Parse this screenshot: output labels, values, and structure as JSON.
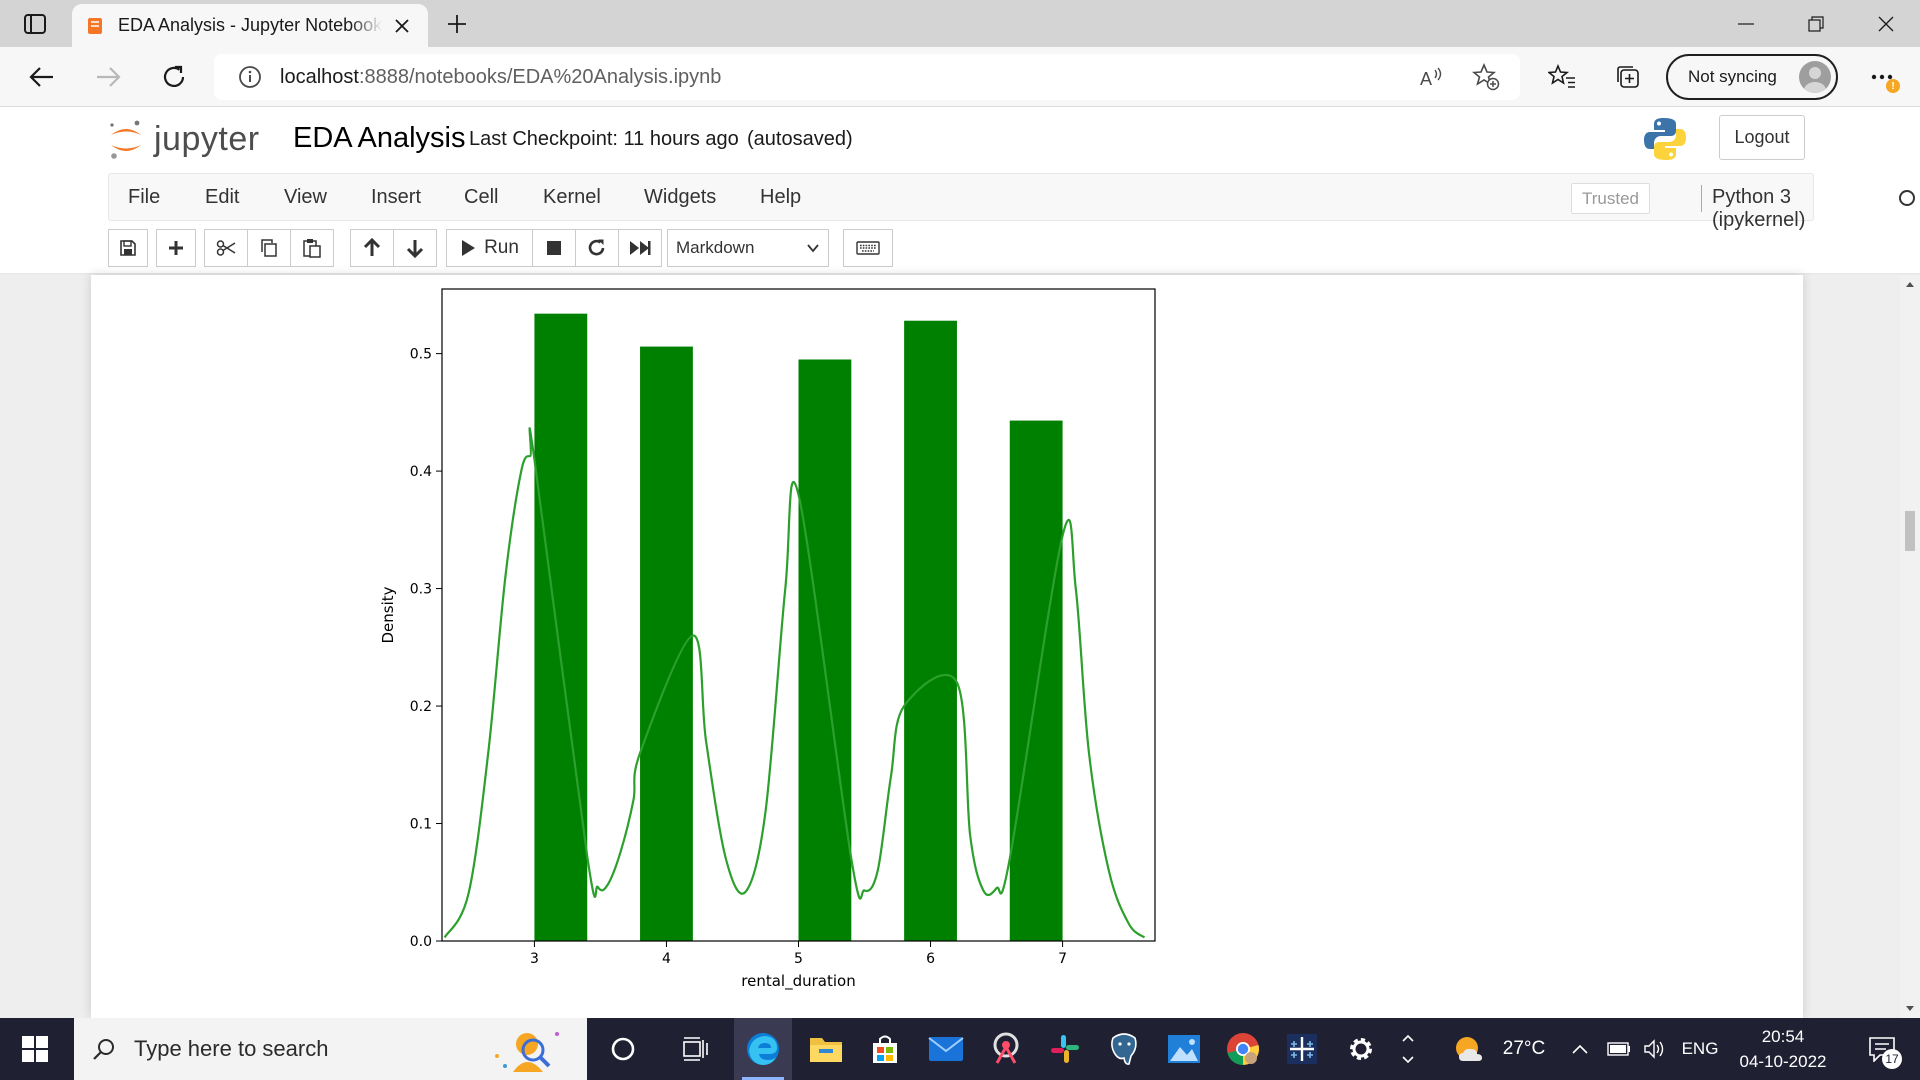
{
  "browser": {
    "tab_title": "EDA Analysis - Jupyter Notebook",
    "url_host": "localhost",
    "url_path": ":8888/notebooks/EDA%20Analysis.ipynb",
    "sync_label": "Not syncing"
  },
  "jupyter": {
    "logo_text": "jupyter",
    "notebook_name": "EDA Analysis",
    "checkpoint": "Last Checkpoint: 11 hours ago",
    "autosave": "(autosaved)",
    "logout_label": "Logout",
    "menu": [
      "File",
      "Edit",
      "View",
      "Insert",
      "Cell",
      "Kernel",
      "Widgets",
      "Help"
    ],
    "trusted_label": "Trusted",
    "kernel_name": "Python 3 (ipykernel)",
    "run_label": "Run",
    "cell_type": "Markdown"
  },
  "chart_data": {
    "type": "bar",
    "xlabel": "rental_duration",
    "ylabel": "Density",
    "x_ticks": [
      3,
      4,
      5,
      6,
      7
    ],
    "y_ticks": [
      0.0,
      0.1,
      0.2,
      0.3,
      0.4,
      0.5
    ],
    "xlim": [
      2.3,
      7.7
    ],
    "ylim": [
      0.0,
      0.555
    ],
    "bar_color": "#008000",
    "kde_color": "#2ca02c",
    "bars": [
      {
        "x0": 3.0,
        "x1": 3.4,
        "density": 0.534
      },
      {
        "x0": 3.8,
        "x1": 4.2,
        "density": 0.506
      },
      {
        "x0": 5.0,
        "x1": 5.4,
        "density": 0.495
      },
      {
        "x0": 5.8,
        "x1": 6.2,
        "density": 0.528
      },
      {
        "x0": 6.6,
        "x1": 7.0,
        "density": 0.443
      }
    ],
    "kde": {
      "x": [
        2.32,
        2.5,
        2.65,
        2.78,
        2.9,
        2.97,
        3.0,
        3.4,
        3.48,
        3.55,
        3.65,
        3.75,
        3.8,
        4.2,
        4.3,
        4.45,
        4.6,
        4.75,
        4.9,
        5.0,
        5.4,
        5.5,
        5.6,
        5.7,
        5.8,
        6.2,
        6.3,
        6.4,
        6.5,
        6.6,
        7.0,
        7.1,
        7.2,
        7.35,
        7.5,
        7.62
      ],
      "y": [
        0.003,
        0.04,
        0.16,
        0.31,
        0.4,
        0.413,
        0.41,
        0.072,
        0.046,
        0.047,
        0.075,
        0.12,
        0.16,
        0.26,
        0.17,
        0.07,
        0.042,
        0.11,
        0.3,
        0.38,
        0.07,
        0.043,
        0.06,
        0.14,
        0.2,
        0.22,
        0.09,
        0.043,
        0.045,
        0.07,
        0.345,
        0.3,
        0.16,
        0.06,
        0.015,
        0.003
      ]
    }
  },
  "taskbar": {
    "search_placeholder": "Type here to search",
    "weather": "27°C",
    "language": "ENG",
    "time": "20:54",
    "date": "04-10-2022",
    "notification_count": "17"
  },
  "colors": {
    "jupyter_orange": "#f37726",
    "taskbar_bg": "#202033",
    "edge_blue": "#0c7ed7"
  }
}
